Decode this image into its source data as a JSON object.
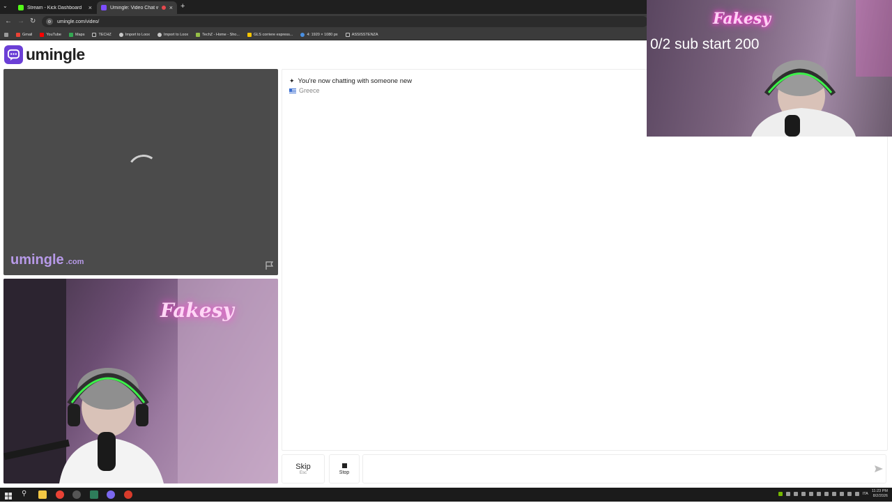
{
  "browser": {
    "tabs": [
      {
        "title": "Stream - Kick Dashboard",
        "close": "×",
        "active": false,
        "favicon_color": "#53fc18"
      },
      {
        "title": "Umingle: Video Chat with S",
        "close": "×",
        "active": true,
        "favicon_color": "#7c4dff"
      }
    ],
    "new_tab": "+",
    "tab_menu": "⌄",
    "url": "umingle.com/video/",
    "bookmarks": [
      {
        "label": "Gmail",
        "color": "#ea4335"
      },
      {
        "label": "YouTube",
        "color": "#ff0000"
      },
      {
        "label": "Maps",
        "color": "#34a853"
      },
      {
        "label": "TECHZ",
        "color": "#c8c8c8"
      },
      {
        "label": "Import to Loox",
        "color": "#c8c8c8"
      },
      {
        "label": "Import to Loox",
        "color": "#c8c8c8"
      },
      {
        "label": "TechZ - Home - Sho...",
        "color": "#95bf47"
      },
      {
        "label": "GLS corriere espress...",
        "color": "#f5c400"
      },
      {
        "label": "4: 1920 × 1080 px",
        "color": "#4a90e2"
      },
      {
        "label": "ASSISSTENZA",
        "color": "#c8c8c8"
      }
    ]
  },
  "site": {
    "logo_text": "umingle",
    "brand_color": "#6b3fd6"
  },
  "stranger_video": {
    "watermark": "umingle",
    "watermark_suffix": ".com"
  },
  "chat": {
    "status_message": "You're now chatting with someone new",
    "country": "Greece"
  },
  "controls": {
    "skip_label": "Skip",
    "skip_hint": "Esc",
    "stop_label": "Stop",
    "input_value": "",
    "input_placeholder": ""
  },
  "stream_overlay": {
    "goal_text": "0/2 sub start 200"
  },
  "taskbar": {
    "language": "ITA",
    "time": "11:23 PM",
    "date": "8/2/2026"
  }
}
